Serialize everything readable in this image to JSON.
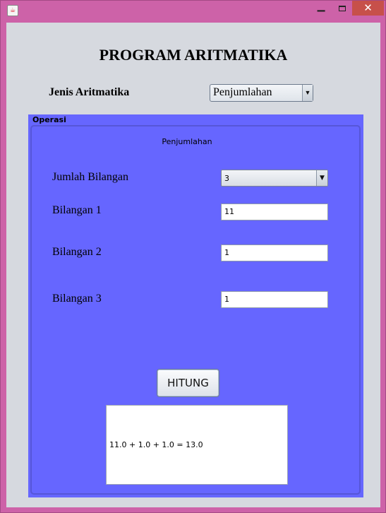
{
  "window": {
    "app_icon": "java-icon",
    "min_glyph": "▁",
    "close_glyph": "✕"
  },
  "header": {
    "title": "PROGRAM ARITMATIKA"
  },
  "jenis": {
    "label": "Jenis Aritmatika",
    "selected": "Penjumlahan",
    "arrow": "▼"
  },
  "operasi": {
    "title": "Operasi",
    "heading": "Penjumlahan",
    "jumlah_label": "Jumlah Bilangan",
    "jumlah_selected": "3",
    "arrow": "▼",
    "fields": [
      {
        "label": "Bilangan 1",
        "value": "11"
      },
      {
        "label": "Bilangan 2",
        "value": "1"
      },
      {
        "label": "Bilangan 3",
        "value": "1"
      }
    ],
    "button_label": "HITUNG",
    "result": "11.0 + 1.0 + 1.0 = 13.0"
  },
  "colors": {
    "window_frame": "#cd62a8",
    "panel_bg": "#6666ff",
    "client_bg": "#d6d9df",
    "close_button": "#c7504a"
  }
}
